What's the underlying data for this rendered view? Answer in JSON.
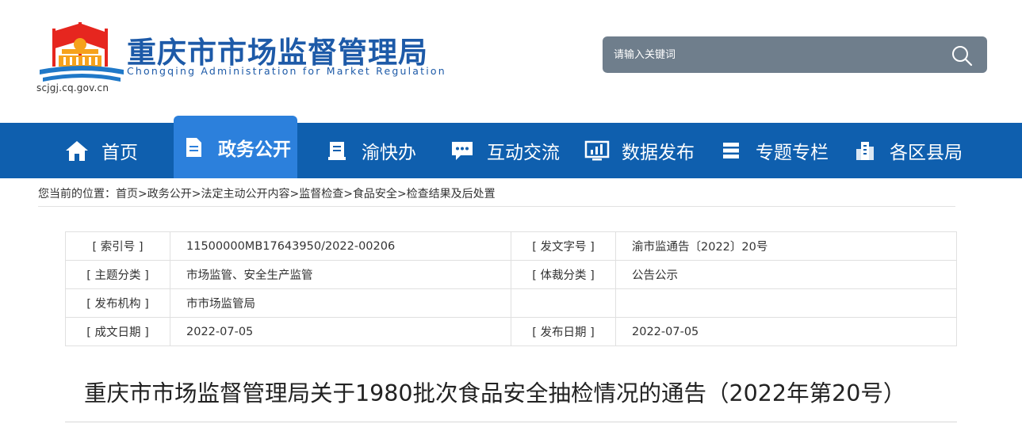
{
  "header": {
    "site_title": "重庆市市场监督管理局",
    "site_subtitle": "Chongqing  Administration for Market Regulation",
    "domain": "scjgj.cq.gov.cn",
    "colors": {
      "brand_blue": "#1d5aa8",
      "logo_red": "#e6261f",
      "logo_orange": "#f6a21c",
      "logo_blue": "#1f78c8"
    }
  },
  "search": {
    "placeholder": "请输入关键词",
    "icon": "search-icon"
  },
  "nav": {
    "items": [
      {
        "label": "首页",
        "icon": "home-icon"
      },
      {
        "label": "政务公开",
        "icon": "document-icon",
        "active": true
      },
      {
        "label": "渝快办",
        "icon": "clipboard-icon"
      },
      {
        "label": "互动交流",
        "icon": "chat-icon"
      },
      {
        "label": "数据发布",
        "icon": "monitor-chart-icon"
      },
      {
        "label": "专题专栏",
        "icon": "stack-icon"
      },
      {
        "label": "各区县局",
        "icon": "buildings-icon"
      }
    ],
    "colors": {
      "bar": "#0f5fae",
      "active": "#2c80dc"
    }
  },
  "breadcrumb": {
    "prefix": "您当前的位置：",
    "items": [
      "首页",
      "政务公开",
      "法定主动公开内容",
      "监督检查",
      "食品安全",
      "检查结果及后处置"
    ],
    "sep": ">"
  },
  "meta": {
    "rows": [
      {
        "l1": "[ 索引号 ]",
        "v1": "11500000MB17643950/2022-00206",
        "l2": "[ 发文字号 ]",
        "v2": "渝市监通告〔2022〕20号"
      },
      {
        "l1": "[ 主题分类 ]",
        "v1": "市场监管、安全生产监管",
        "l2": "[ 体裁分类 ]",
        "v2": "公告公示"
      },
      {
        "l1": "[ 发布机构 ]",
        "v1": "市市场监管局",
        "l2": "",
        "v2": ""
      },
      {
        "l1": "[ 成文日期 ]",
        "v1": "2022-07-05",
        "l2": "[ 发布日期 ]",
        "v2": "2022-07-05"
      }
    ]
  },
  "article": {
    "title": "重庆市市场监督管理局关于1980批次食品安全抽检情况的通告（2022年第20号）"
  }
}
